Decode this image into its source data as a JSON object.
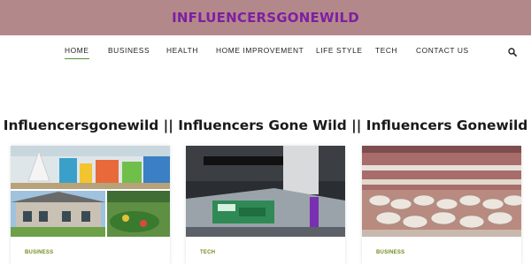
{
  "site": {
    "brand": "INFLUENCERSGONEWILD"
  },
  "nav": {
    "items": [
      {
        "label": "HOME",
        "active": true
      },
      {
        "label": "BUSINESS"
      },
      {
        "label": "HEALTH"
      },
      {
        "label": "HOME IMPROVEMENT"
      },
      {
        "label": "LIFE STYLE"
      },
      {
        "label": "TECH"
      },
      {
        "label": "CONTACT US"
      }
    ],
    "search_icon": "search-icon"
  },
  "page": {
    "heading": "Influencersgonewild || Influencers Gone Wild || Influencers Gonewild"
  },
  "cards": [
    {
      "category": "BUSINESS",
      "title": ""
    },
    {
      "category": "TECH",
      "title": ""
    },
    {
      "category": "BUSINESS",
      "title": ""
    }
  ],
  "colors": {
    "topbar": "#b3888a",
    "brand": "#7d1fa2",
    "accent": "#5a8f3a",
    "category": "#6f8d1f"
  }
}
